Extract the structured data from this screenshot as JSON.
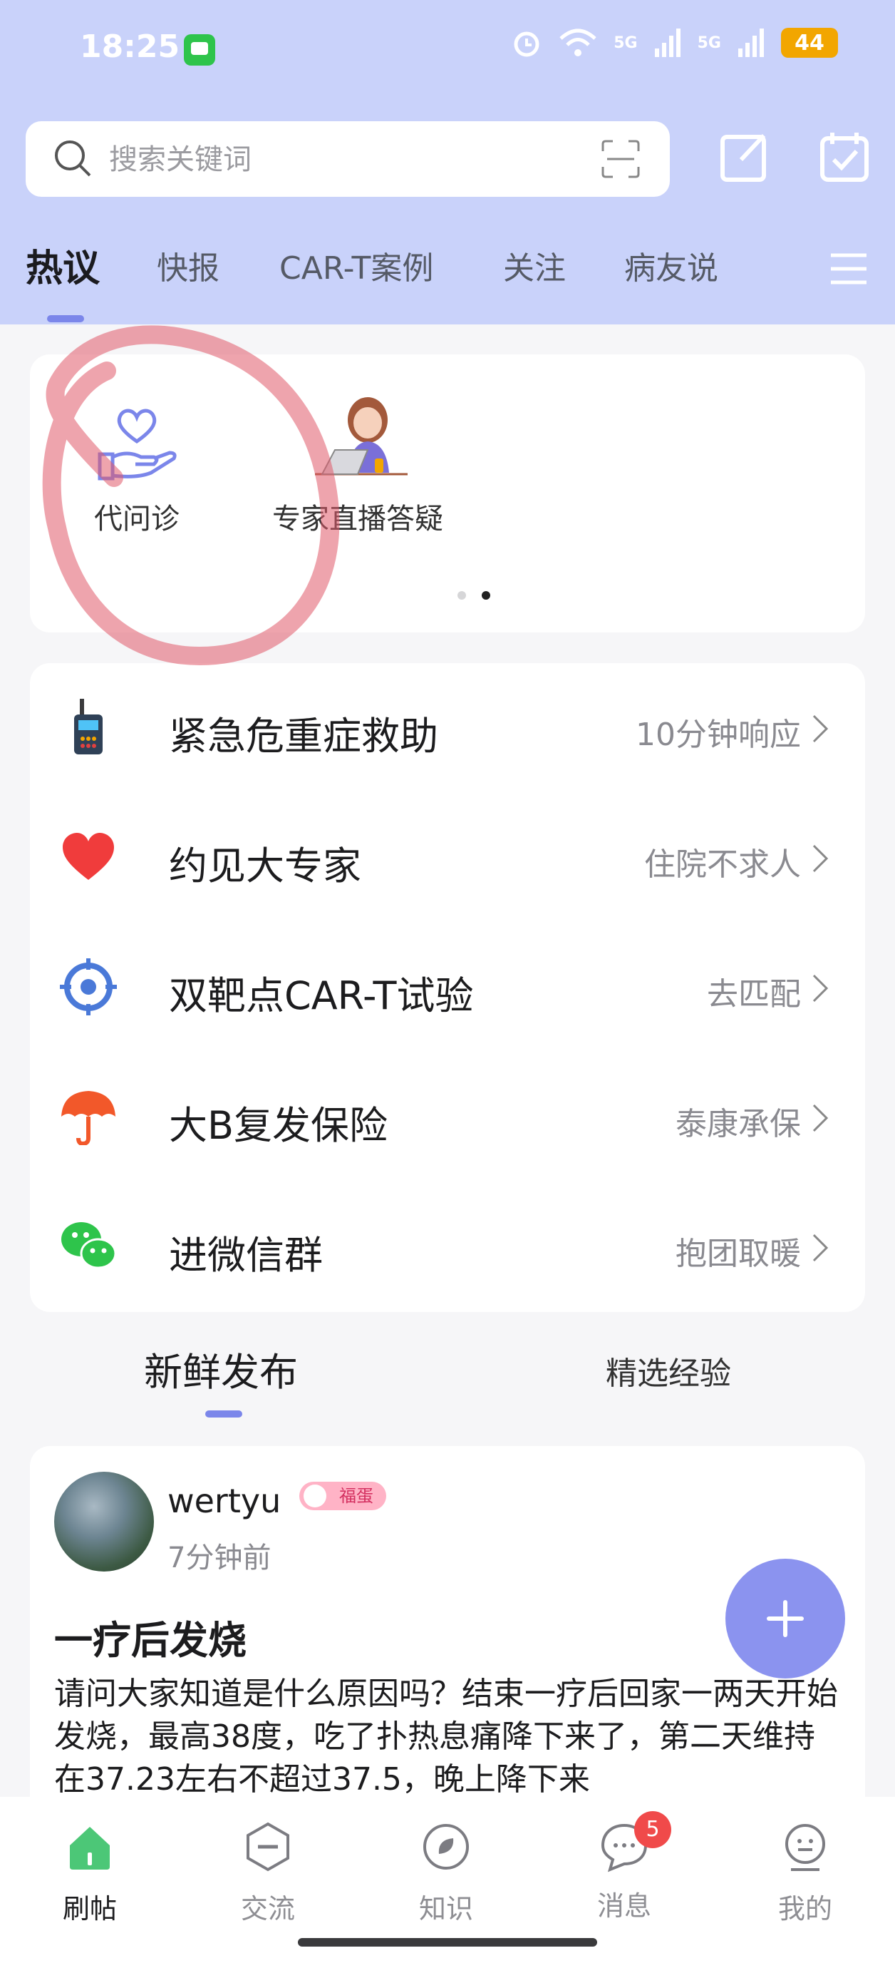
{
  "status_bar": {
    "time": "18:25",
    "network": "5G",
    "battery": "44"
  },
  "search": {
    "placeholder": "搜索关键词"
  },
  "tabs": [
    "热议",
    "快报",
    "CAR-T案例",
    "关注",
    "病友说"
  ],
  "quick_actions": [
    {
      "label": "代问诊",
      "icon": "heart-hand-icon"
    },
    {
      "label": "专家直播答疑",
      "icon": "doctor-laptop-icon"
    }
  ],
  "services": [
    {
      "title": "紧急危重症救助",
      "subtitle": "10分钟响应",
      "icon": "walkie-talkie-icon"
    },
    {
      "title": "约见大专家",
      "subtitle": "住院不求人",
      "icon": "heart-icon"
    },
    {
      "title": "双靶点CAR-T试验",
      "subtitle": "去匹配",
      "icon": "target-icon"
    },
    {
      "title": "大B复发保险",
      "subtitle": "泰康承保",
      "icon": "umbrella-icon"
    },
    {
      "title": "进微信群",
      "subtitle": "抱团取暖",
      "icon": "wechat-icon"
    }
  ],
  "feed_tabs": [
    "新鲜发布",
    "精选经验"
  ],
  "post": {
    "username": "wertyu",
    "badge": "福蛋",
    "time": "7分钟前",
    "title": "一疗后发烧",
    "body": "请问大家知道是什么原因吗？结束一疗后回家一两天开始发烧，最高38度，吃了扑热息痛降下来了，第二天维持在37.23左右不超过37.5，晚上降下来"
  },
  "bottom_nav": [
    {
      "label": "刷帖",
      "icon": "home-icon"
    },
    {
      "label": "交流",
      "icon": "minus-hexagon-icon"
    },
    {
      "label": "知识",
      "icon": "leaf-icon"
    },
    {
      "label": "消息",
      "icon": "chat-bubble-icon",
      "badge": "5"
    },
    {
      "label": "我的",
      "icon": "face-icon"
    }
  ],
  "colors": {
    "header": "#c9d2fa",
    "accent": "#7b86ea",
    "fab": "#8b93ef",
    "badge": "#f04a4a",
    "annotation": "#e05a6a"
  }
}
